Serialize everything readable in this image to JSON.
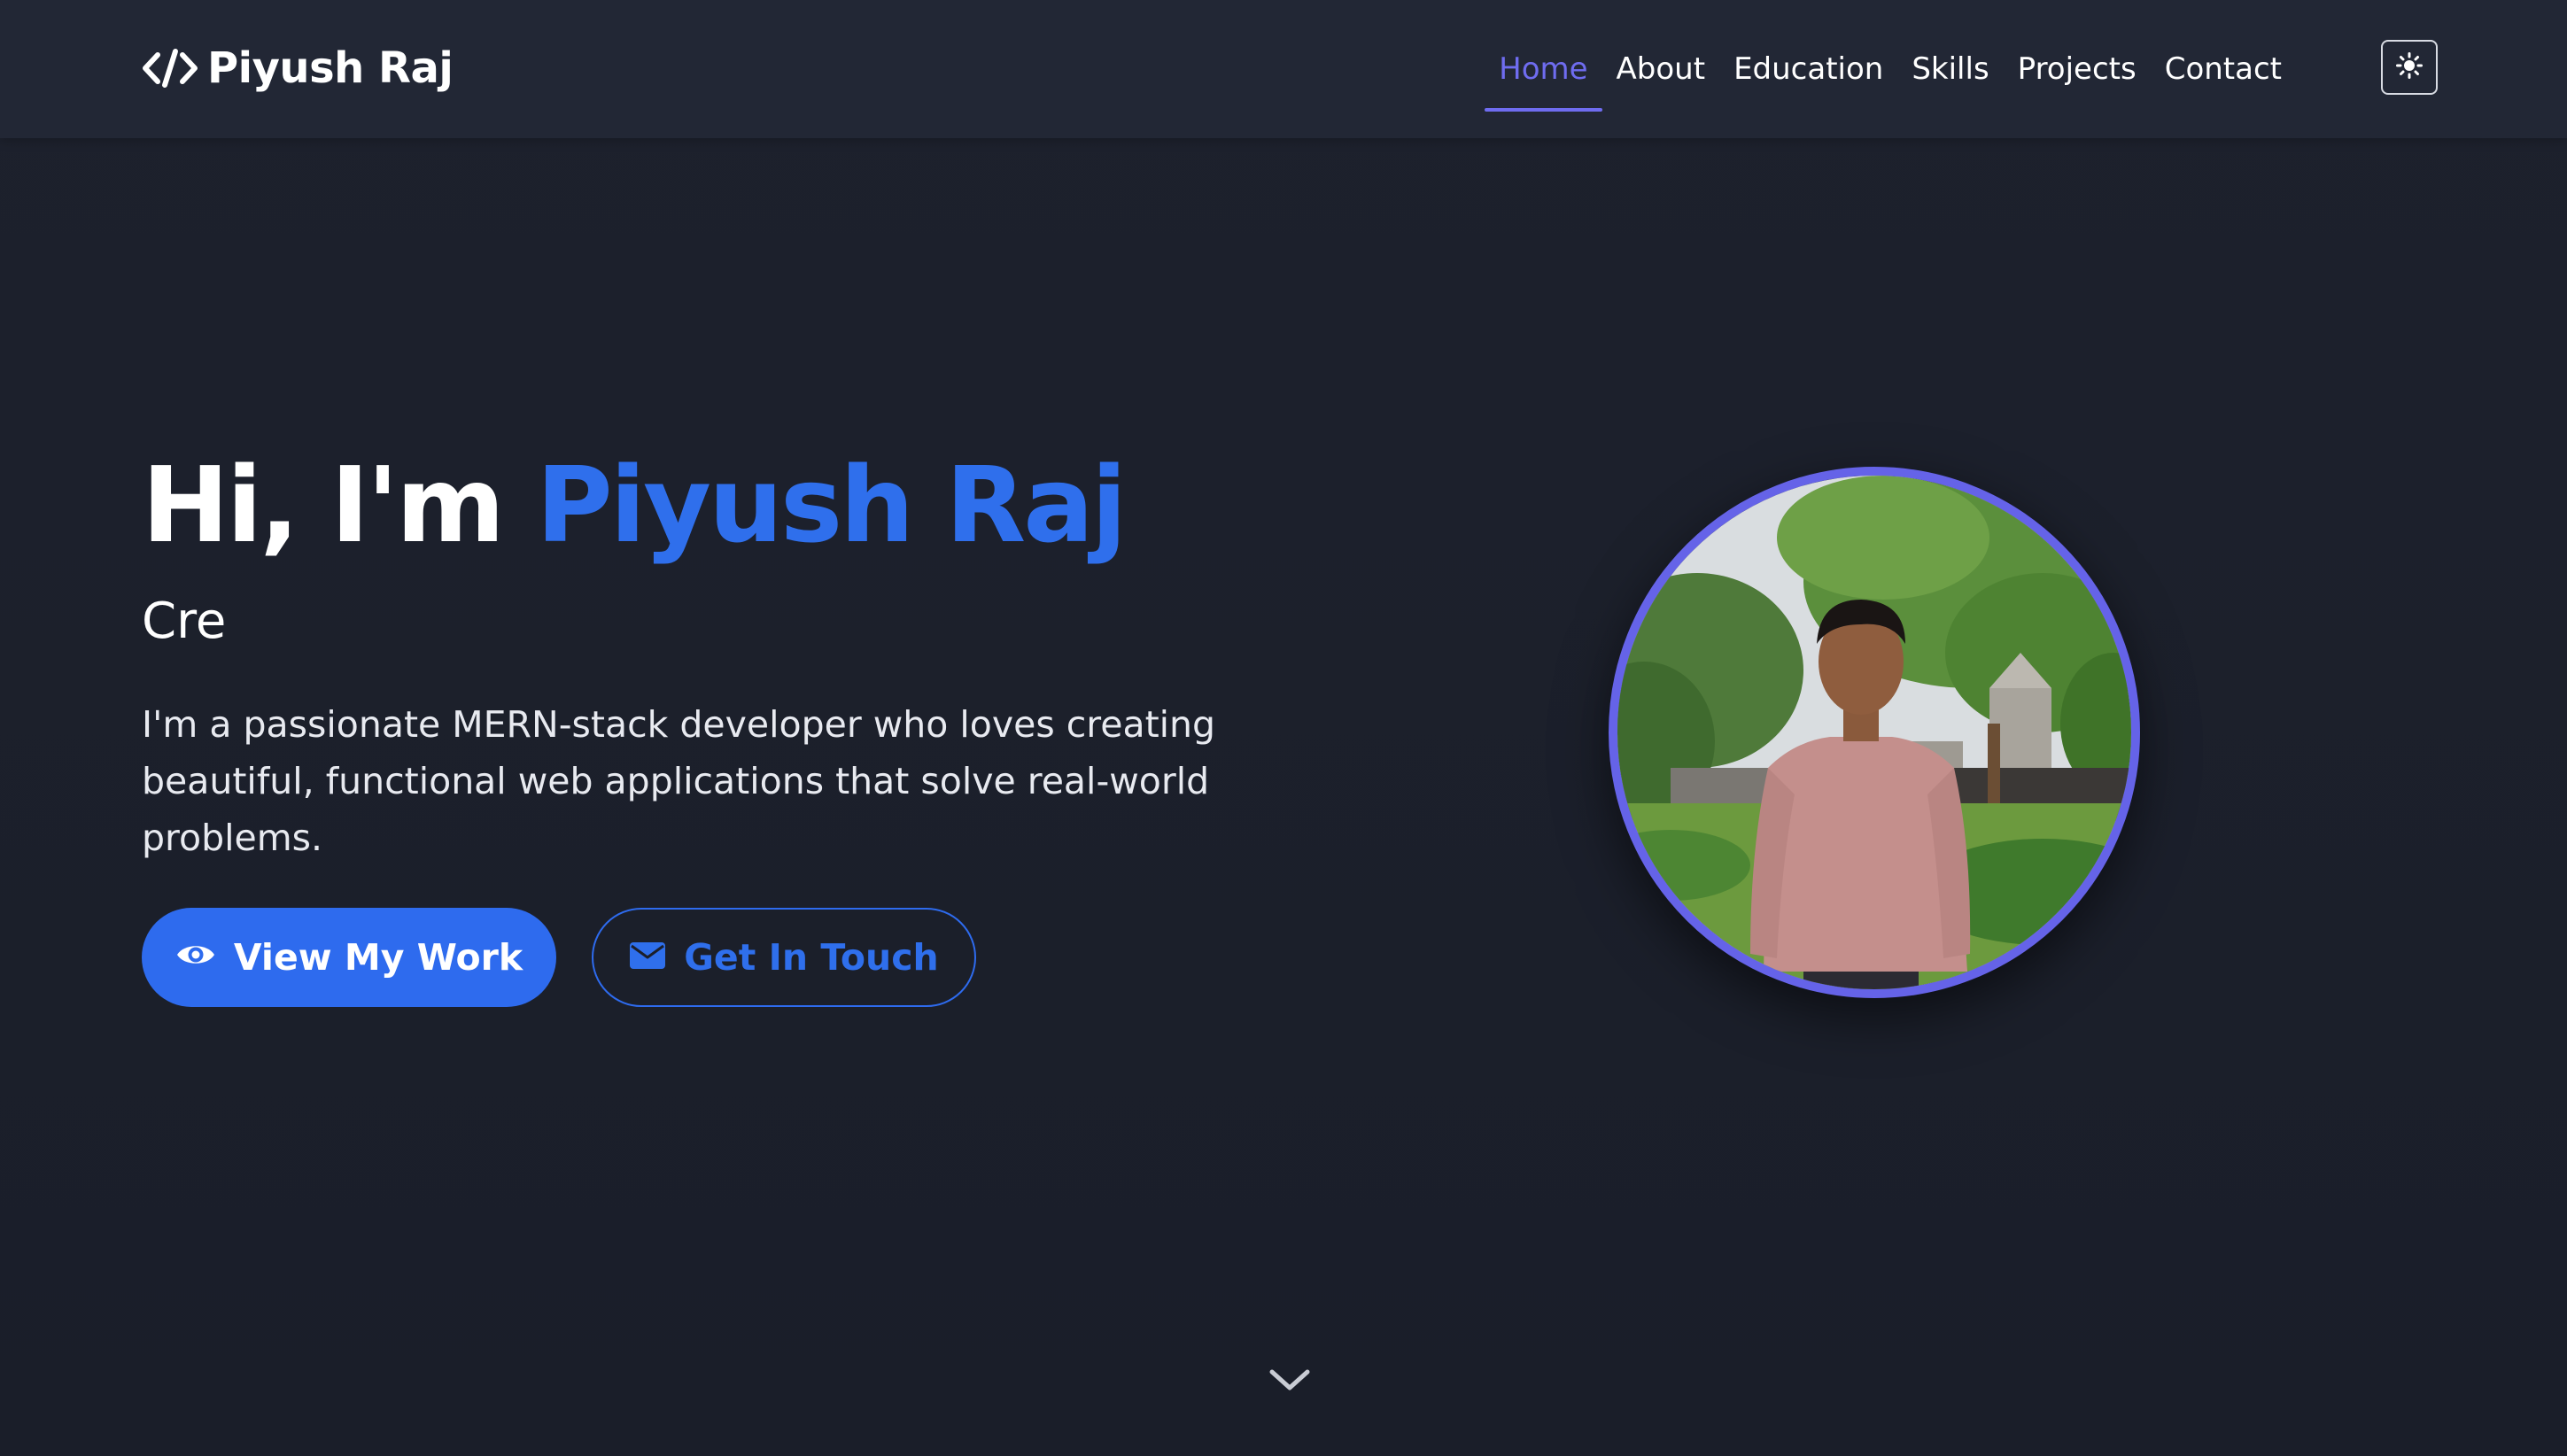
{
  "brand": {
    "logo_icon": "code-icon",
    "name": "Piyush Raj"
  },
  "nav": {
    "items": [
      {
        "label": "Home",
        "active": true
      },
      {
        "label": "About",
        "active": false
      },
      {
        "label": "Education",
        "active": false
      },
      {
        "label": "Skills",
        "active": false
      },
      {
        "label": "Projects",
        "active": false
      },
      {
        "label": "Contact",
        "active": false
      }
    ],
    "theme_toggle_icon": "sun-icon"
  },
  "hero": {
    "greeting": "Hi, I'm",
    "name": "Piyush Raj",
    "typed_text": "Cre",
    "description": "I'm a passionate MERN-stack developer who loves creating beautiful, functional web applications that solve real-world problems.",
    "primary_button": {
      "label": "View My Work",
      "icon": "eye-icon"
    },
    "secondary_button": {
      "label": "Get In Touch",
      "icon": "envelope-icon"
    },
    "profile_photo_icon": "profile-photo"
  },
  "scroll_indicator_icon": "chevron-down-icon",
  "colors": {
    "background": "#1b1f2b",
    "navbar": "#222735",
    "accent_blue": "#2e6bee",
    "nav_active": "#6f6cf0",
    "avatar_ring": "#6563e8"
  }
}
